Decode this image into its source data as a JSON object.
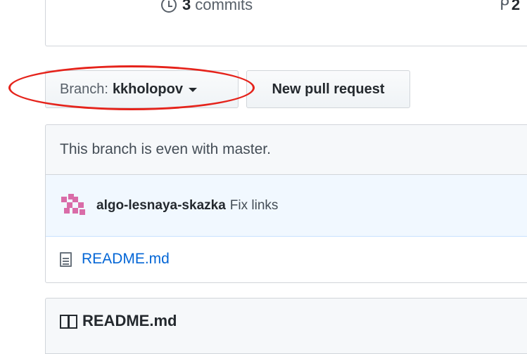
{
  "stats": {
    "commits_count": "3",
    "commits_label": "commits",
    "pull_requests_count": "2"
  },
  "branch_selector": {
    "label": "Branch:",
    "branch_name": "kkholopov"
  },
  "new_pull_request_label": "New pull request",
  "branch_status": "This branch is even with master.",
  "latest_commit": {
    "author": "algo-lesnaya-skazka",
    "message": "Fix links"
  },
  "files": [
    {
      "name": "README.md",
      "icon": "file-text-icon"
    }
  ],
  "readme": {
    "title": "README.md",
    "icon": "book-icon"
  },
  "colors": {
    "link": "#0366d6",
    "annotation": "#e5231b",
    "avatar": "#d96ca8"
  }
}
